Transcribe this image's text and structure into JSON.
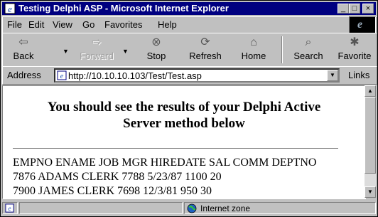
{
  "window": {
    "title": "Testing Delphi ASP - Microsoft Internet Explorer",
    "controls": {
      "minimize": "_",
      "maximize": "□",
      "close": "×"
    }
  },
  "menu": [
    "File",
    "Edit",
    "View",
    "Go",
    "Favorites",
    "Help"
  ],
  "toolbar": {
    "back": "Back",
    "forward": "Forward",
    "stop": "Stop",
    "refresh": "Refresh",
    "home": "Home",
    "search": "Search",
    "favorites": "Favorite"
  },
  "address": {
    "label": "Address",
    "url": "http://10.10.10.103/Test/Test.asp",
    "links": "Links"
  },
  "content": {
    "heading_line1": "You should see the results of your Delphi Active",
    "heading_line2": "Server method below",
    "rows": [
      "EMPNO ENAME JOB MGR HIREDATE SAL COMM DEPTNO",
      "7876 ADAMS CLERK 7788 5/23/87 1100 20",
      "7900 JAMES CLERK 7698 12/3/81 950 30"
    ]
  },
  "status": {
    "zone": "Internet zone"
  },
  "icons": {
    "back": "arrow-left-icon",
    "forward": "arrow-right-icon",
    "stop": "stop-icon",
    "refresh": "refresh-icon",
    "home": "home-icon",
    "search": "search-icon",
    "favorites": "favorites-icon"
  },
  "colors": {
    "titlebar": "#000080",
    "chrome": "#c0c0c0",
    "page": "#ffffff"
  }
}
